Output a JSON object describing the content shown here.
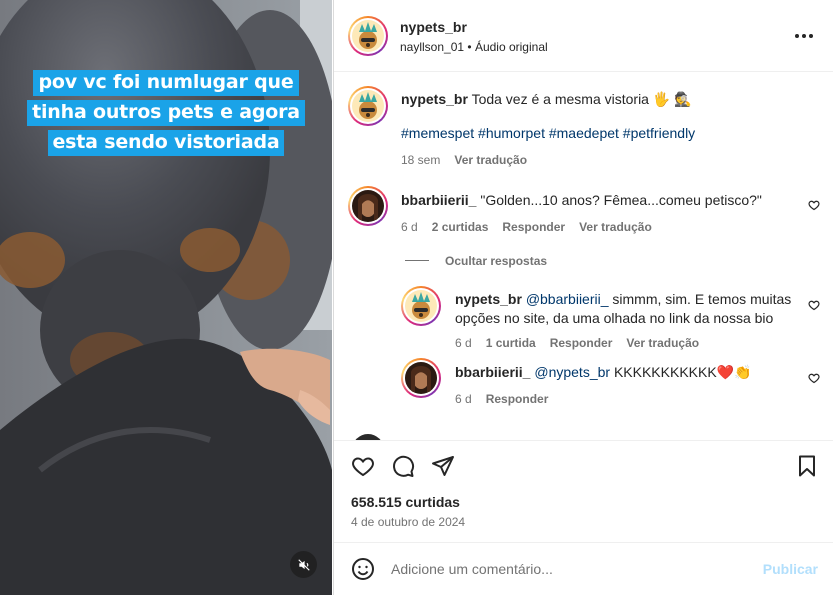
{
  "media": {
    "overlay_lines": [
      "pov vc foi numlugar que",
      "tinha outros pets e agora",
      "esta sendo vistoriada"
    ],
    "mute_icon": "speaker-muted-icon"
  },
  "header": {
    "username": "nypets_br",
    "subtitle_user": "nayllson_01",
    "subtitle_sep": " • ",
    "subtitle_audio": "Áudio original",
    "more_icon": "more-horizontal-icon"
  },
  "caption": {
    "username": "nypets_br",
    "text": "Toda vez é a mesma vistoria 🖐 🕵",
    "hashtags": "#memespet #humorpet #maedepet #petfriendly",
    "time": "18 sem",
    "translate": "Ver tradução"
  },
  "comments": [
    {
      "username": "bbarbiierii_",
      "text": "\"Golden...10 anos? Fêmea...comeu petisco?\"",
      "time": "6 d",
      "likes": "2 curtidas",
      "reply": "Responder",
      "translate": "Ver tradução"
    }
  ],
  "hide_replies": "Ocultar respostas",
  "replies": [
    {
      "username": "nypets_br",
      "mention": "@bbarbiierii_",
      "text_line1": " simmm, sim. E temos muitas",
      "text_line2": "opções no site, da uma olhada no link da nossa bio",
      "time": "6 d",
      "likes": "1 curtida",
      "reply": "Responder",
      "translate": "Ver tradução"
    },
    {
      "username": "bbarbiierii_",
      "mention": "@nypets_br",
      "text": " KKKKKKKKKKK❤️👏",
      "time": "6 d",
      "reply": "Responder"
    }
  ],
  "actions": {
    "like_icon": "heart-icon",
    "comment_icon": "comment-icon",
    "share_icon": "send-icon",
    "save_icon": "bookmark-icon",
    "likes_count": "658.515 curtidas",
    "date": "4 de outubro de 2024"
  },
  "add_comment": {
    "emoji_icon": "emoji-icon",
    "placeholder": "Adicione um comentário...",
    "publish": "Publicar"
  },
  "colors": {
    "overlay_bg": "#1aa3e8",
    "link": "#00376b",
    "muted": "#737373",
    "publish_disabled": "#b2dffc",
    "heart_red": "#ff3040"
  }
}
